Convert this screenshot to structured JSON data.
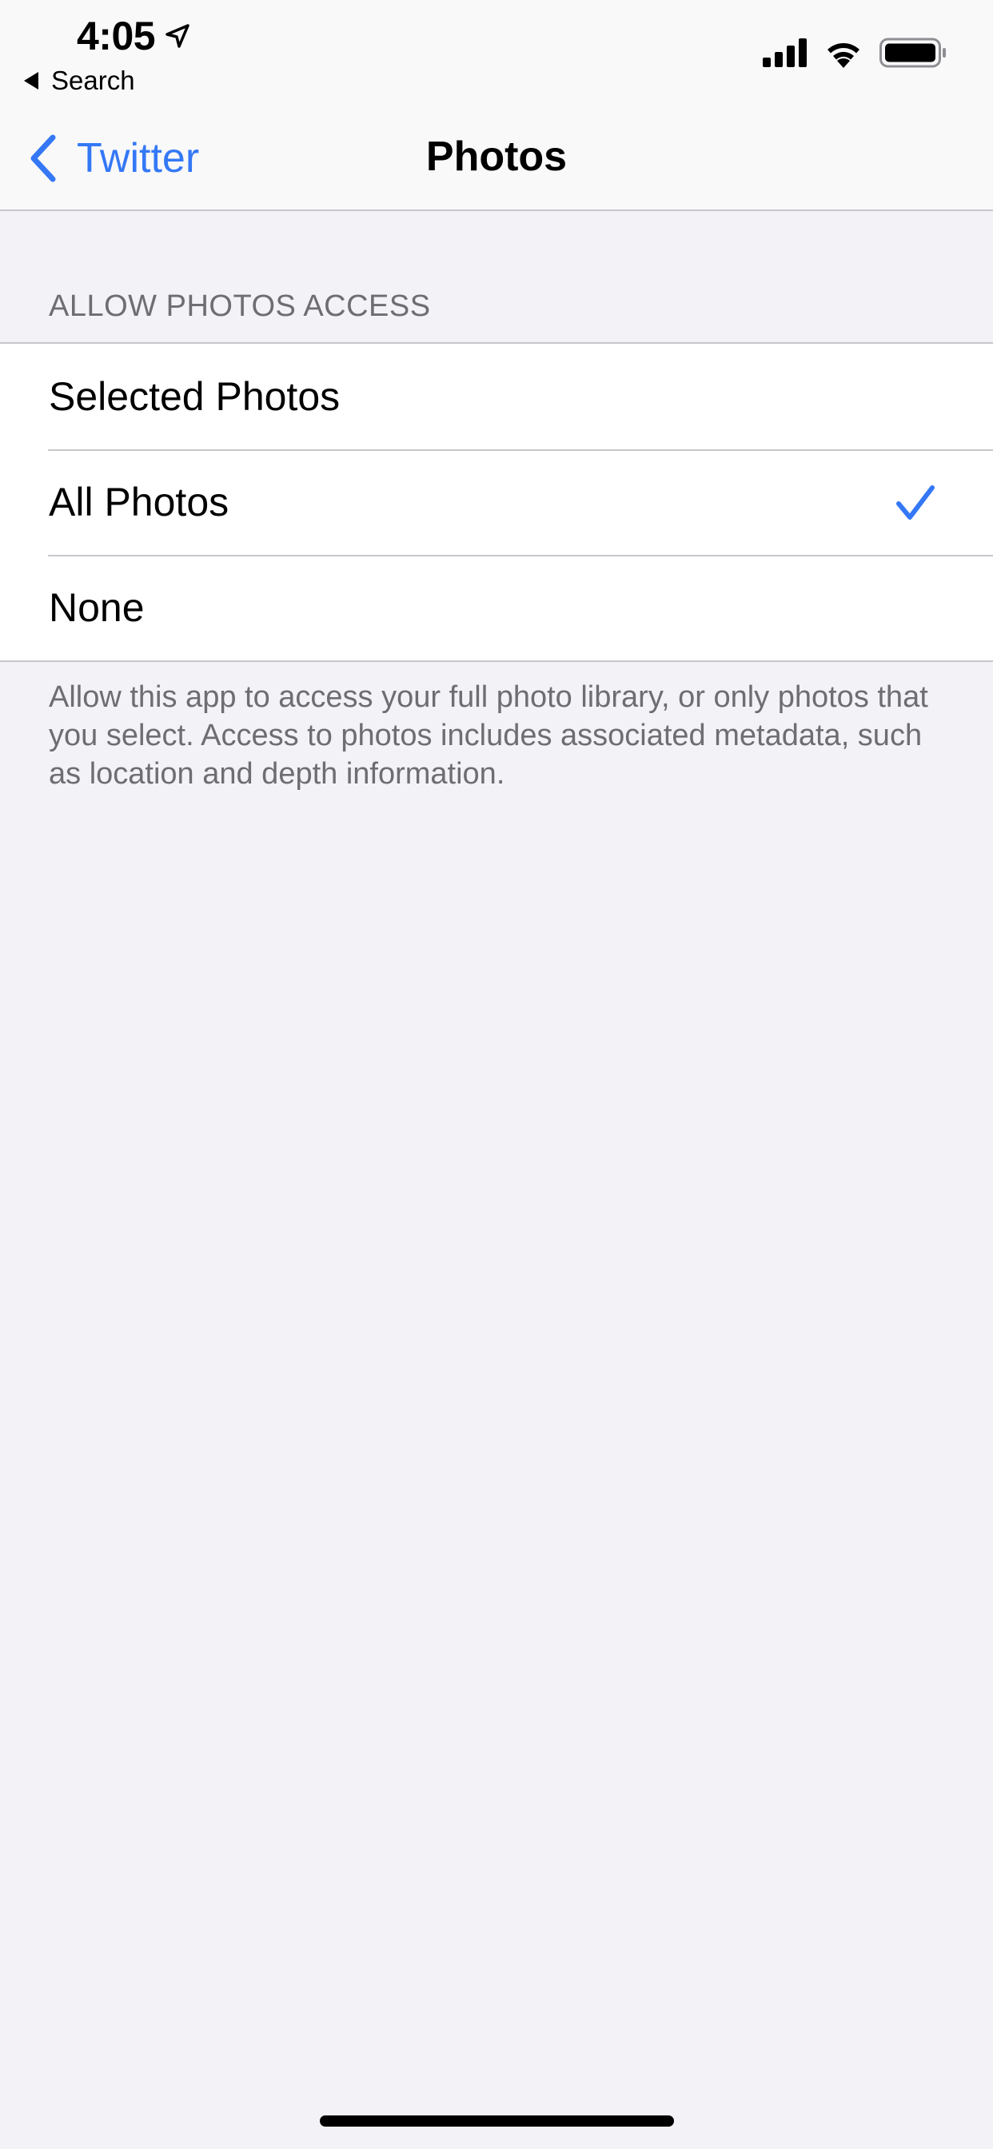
{
  "status_bar": {
    "time": "4:05",
    "back_app": "Search",
    "icons": [
      "location-arrow-icon",
      "cellular-signal-icon",
      "wifi-icon",
      "battery-icon"
    ]
  },
  "nav": {
    "back_label": "Twitter",
    "title": "Photos"
  },
  "section": {
    "header": "ALLOW PHOTOS ACCESS",
    "options": [
      {
        "label": "Selected Photos",
        "selected": false
      },
      {
        "label": "All Photos",
        "selected": true
      },
      {
        "label": "None",
        "selected": false
      }
    ],
    "footer": "Allow this app to access your full photo library, or only photos that you select. Access to photos includes associated metadata, such as location and depth information."
  },
  "colors": {
    "accent": "#3478f6",
    "background": "#f2f2f7",
    "secondary_text": "#6d6d72",
    "separator": "#c8c7cc"
  }
}
